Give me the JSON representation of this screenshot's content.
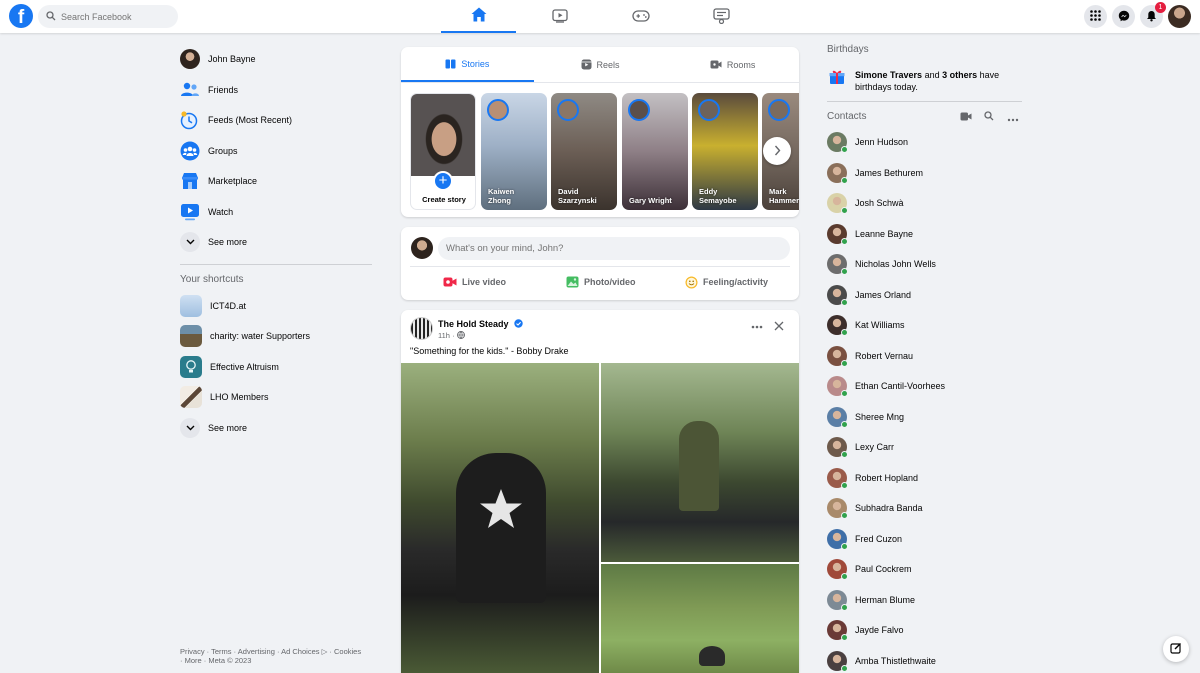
{
  "search": {
    "placeholder": "Search Facebook"
  },
  "notifications": {
    "count": "1"
  },
  "sidebar": {
    "items": [
      {
        "label": "John Bayne",
        "icon": "profile-avatar"
      },
      {
        "label": "Friends",
        "icon": "friends-icon"
      },
      {
        "label": "Feeds (Most Recent)",
        "icon": "feeds-icon"
      },
      {
        "label": "Groups",
        "icon": "groups-icon"
      },
      {
        "label": "Marketplace",
        "icon": "marketplace-icon"
      },
      {
        "label": "Watch",
        "icon": "watch-icon"
      },
      {
        "label": "See more",
        "icon": "chevron-down-icon"
      }
    ],
    "shortcuts_title": "Your shortcuts",
    "shortcuts": [
      {
        "label": "ICT4D.at"
      },
      {
        "label": "charity: water Supporters"
      },
      {
        "label": "Effective Altruism"
      },
      {
        "label": "LHO Members"
      },
      {
        "label": "See more"
      }
    ]
  },
  "footer": {
    "line1": "Privacy · Terms · Advertising · Ad Choices ▷ · Cookies",
    "line2": "· More · Meta © 2023"
  },
  "stories": {
    "tabs": [
      {
        "label": "Stories"
      },
      {
        "label": "Reels"
      },
      {
        "label": "Rooms"
      }
    ],
    "create_label": "Create story",
    "items": [
      {
        "name": "Kaiwen Zhong"
      },
      {
        "name": "David Szarzynski"
      },
      {
        "name": "Gary Wright"
      },
      {
        "name": "Eddy Semayobe"
      },
      {
        "name": "Mark Hammer"
      }
    ]
  },
  "composer": {
    "placeholder": "What's on your mind, John?",
    "actions": [
      {
        "label": "Live video"
      },
      {
        "label": "Photo/video"
      },
      {
        "label": "Feeling/activity"
      }
    ]
  },
  "post": {
    "author": "The Hold Steady",
    "time": "11h",
    "text": "\"Something for the kids.\" - Bobby Drake"
  },
  "birthdays": {
    "title": "Birthdays",
    "name": "Simone Travers",
    "and": "and",
    "others": "3 others",
    "rest": "have birthdays today."
  },
  "contacts": {
    "title": "Contacts",
    "items": [
      {
        "name": "Jenn Hudson",
        "color": "#6b7b63"
      },
      {
        "name": "James Bethurem",
        "color": "#8a6f5a"
      },
      {
        "name": "Josh Schwà",
        "color": "#d9d2a8"
      },
      {
        "name": "Leanne Bayne",
        "color": "#5a3b2e"
      },
      {
        "name": "Nicholas John Wells",
        "color": "#6d6d6d"
      },
      {
        "name": "James Orland",
        "color": "#4b4b4b"
      },
      {
        "name": "Kat Williams",
        "color": "#3d2e2b"
      },
      {
        "name": "Robert Vernau",
        "color": "#7a5040"
      },
      {
        "name": "Ethan Cantil-Voorhees",
        "color": "#b98a8a"
      },
      {
        "name": "Sheree Mng",
        "color": "#5b7fa6"
      },
      {
        "name": "Lexy Carr",
        "color": "#6e5a4b"
      },
      {
        "name": "Robert Hopland",
        "color": "#9a5b4a"
      },
      {
        "name": "Subhadra Banda",
        "color": "#a98a6a"
      },
      {
        "name": "Fred Cuzon",
        "color": "#3f6fa8"
      },
      {
        "name": "Paul Cockrem",
        "color": "#a04a3a"
      },
      {
        "name": "Herman Blume",
        "color": "#7d8a95"
      },
      {
        "name": "Jayde Falvo",
        "color": "#6a3a36"
      },
      {
        "name": "Amba Thistlethwaite",
        "color": "#4a4040"
      }
    ]
  },
  "colors": {
    "accent": "#1877f2",
    "online": "#31a24c",
    "badge": "#e41e3f"
  }
}
